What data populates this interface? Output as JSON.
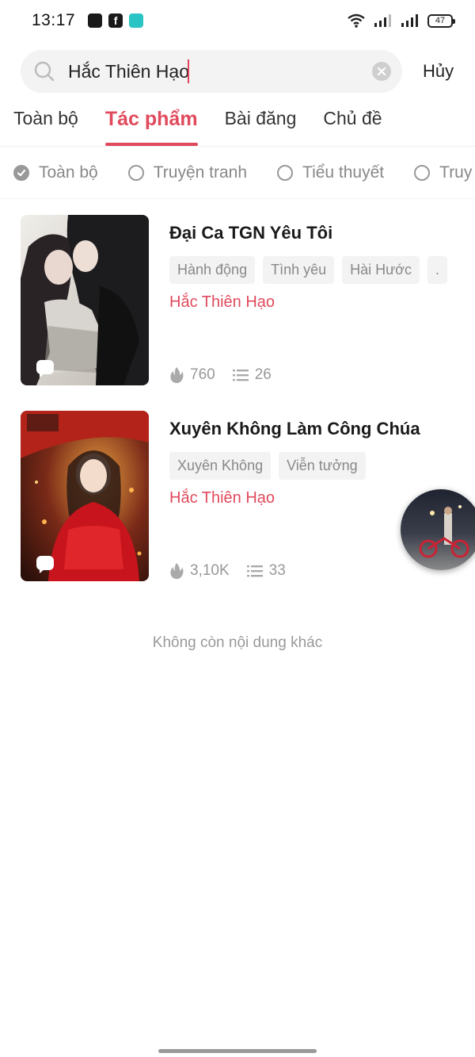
{
  "status_bar": {
    "time": "13:17",
    "battery": "47",
    "app_icons": [
      "stack-app-icon",
      "facebook-icon",
      "messenger-icon"
    ]
  },
  "search": {
    "value": "Hắc Thiên Hạo",
    "cancel_label": "Hủy"
  },
  "tabs": [
    {
      "label": "Toàn bộ",
      "active": false
    },
    {
      "label": "Tác phẩm",
      "active": true
    },
    {
      "label": "Bài đăng",
      "active": false
    },
    {
      "label": "Chủ đề",
      "active": false
    }
  ],
  "filters": [
    {
      "label": "Toàn bộ",
      "checked": true
    },
    {
      "label": "Truyện tranh",
      "checked": false
    },
    {
      "label": "Tiểu thuyết",
      "checked": false
    },
    {
      "label": "Truy",
      "checked": false
    }
  ],
  "results": [
    {
      "title": "Đại Ca TGN Yêu Tôi",
      "tags": [
        "Hành động",
        "Tình yêu",
        "Hài Hước",
        "."
      ],
      "author": "Hắc Thiên Hạo",
      "views": "760",
      "chapters": "26"
    },
    {
      "title": "Xuyên Không Làm Công Chúa",
      "tags": [
        "Xuyên Không",
        "Viễn tưởng"
      ],
      "author": "Hắc Thiên Hạo",
      "views": "3,10K",
      "chapters": "33"
    }
  ],
  "end_message": "Không còn nội dung khác",
  "colors": {
    "accent": "#e04a5c",
    "muted_text": "#999999",
    "tag_bg": "#f3f3f3"
  }
}
